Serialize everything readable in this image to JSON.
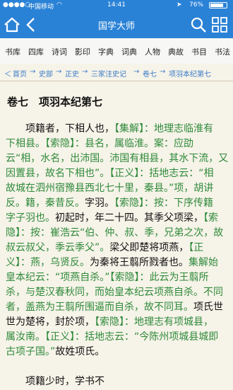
{
  "status": {
    "carrier": "中国移动",
    "time": "14:41",
    "battery": "76%"
  },
  "app": {
    "title": "国学大师"
  },
  "categories": [
    "书库",
    "四库",
    "诗词",
    "影印",
    "字典",
    "词典",
    "人物",
    "典故",
    "书目",
    "书法"
  ],
  "breadcrumb": [
    "首页",
    "史部",
    "正史",
    "三家注史记",
    "卷七",
    "项羽本纪第七"
  ],
  "chapter_title": "卷七　项羽本纪第七",
  "lines": [
    [
      {
        "t": "　　项籍者，下相人也，",
        "g": false
      },
      {
        "t": "【集解】：地理志临淮有",
        "g": true
      }
    ],
    [
      {
        "t": "下相县。【索隐】：县名，属临淮。案：应劭",
        "g": true
      }
    ],
    [
      {
        "t": "云“相，水名，出沛国。沛国有相县，其水下流，又",
        "g": true
      }
    ],
    [
      {
        "t": "因置县，故名下相也”。【正义】：括地志云：“相",
        "g": true
      }
    ],
    [
      {
        "t": "故城在泗州宿豫县西北七十里，秦县。”项，胡讲",
        "g": true
      }
    ],
    [
      {
        "t": "反。籍，秦昔反。",
        "g": true
      },
      {
        "t": "字羽。",
        "g": false
      },
      {
        "t": "【索隐】：按：下序传籍",
        "g": true
      }
    ],
    [
      {
        "t": "字子羽也。",
        "g": true
      },
      {
        "t": "初起时，年二十四。其季父项梁，",
        "g": false
      },
      {
        "t": "【索",
        "g": true
      }
    ],
    [
      {
        "t": "隐】：按：崔浩云“伯、仲、叔、季，兄弟之次，故",
        "g": true
      }
    ],
    [
      {
        "t": "叔云叔父，季云季父”。",
        "g": true
      },
      {
        "t": "梁父即楚将项燕，",
        "g": false
      },
      {
        "t": "【正",
        "g": true
      }
    ],
    [
      {
        "t": "义】：燕，乌贤反。",
        "g": true
      },
      {
        "t": "为秦将王翦所戮者也。",
        "g": false
      },
      {
        "t": "集解始",
        "g": true
      }
    ],
    [
      {
        "t": "皇本纪云：“项燕自杀。”【索隐】：此云为王翦所",
        "g": true
      }
    ],
    [
      {
        "t": "杀，与楚汉春秋同，而始皇本纪云项燕自杀。不同",
        "g": true
      }
    ],
    [
      {
        "t": "者，盖燕为王翦所围逼而自杀，故不同耳。",
        "g": true
      },
      {
        "t": "项氏世",
        "g": false
      }
    ],
    [
      {
        "t": "世为楚将，封於项，",
        "g": false
      },
      {
        "t": "【索隐】：地理志有项城县，",
        "g": true
      }
    ],
    [
      {
        "t": "属汝南。【正义】：括地志云：“今陈州项城县城即",
        "g": true
      }
    ],
    [
      {
        "t": "古项子国。”",
        "g": true
      },
      {
        "t": "故姓项氏。",
        "g": false
      }
    ],
    [
      {
        "t": "",
        "g": false
      }
    ],
    [
      {
        "t": "　　项籍少时，学书不",
        "g": false
      }
    ]
  ]
}
